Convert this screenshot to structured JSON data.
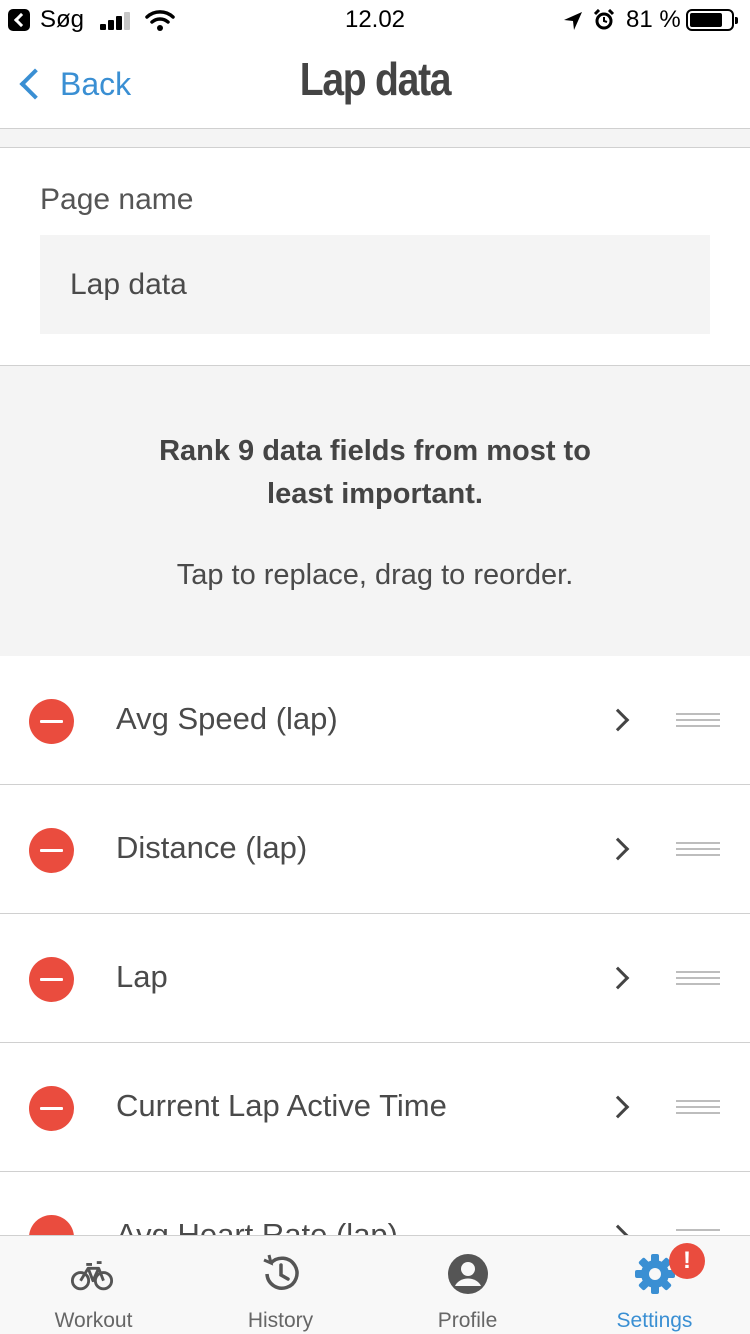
{
  "status_bar": {
    "back_app": "Søg",
    "time": "12.02",
    "battery_percent": "81 %",
    "battery_level": 0.81,
    "icons": [
      "back-to-app-icon",
      "signal-icon",
      "wifi-icon",
      "location-arrow-icon",
      "alarm-icon",
      "battery-icon"
    ]
  },
  "nav": {
    "back_label": "Back",
    "title": "Lap data"
  },
  "page_name": {
    "label": "Page name",
    "value": "Lap data"
  },
  "instructions": {
    "heading": "Rank 9 data fields from most to least important.",
    "subtext": "Tap to replace, drag to reorder."
  },
  "fields": [
    {
      "label": "Avg Speed (lap)"
    },
    {
      "label": "Distance (lap)"
    },
    {
      "label": "Lap"
    },
    {
      "label": "Current Lap Active Time"
    },
    {
      "label": "Avg Heart Rate (lap)"
    }
  ],
  "tabbar": {
    "tabs": [
      {
        "label": "Workout",
        "icon": "bike-icon",
        "active": false
      },
      {
        "label": "History",
        "icon": "history-icon",
        "active": false
      },
      {
        "label": "Profile",
        "icon": "profile-icon",
        "active": false
      },
      {
        "label": "Settings",
        "icon": "gear-icon",
        "active": true
      }
    ],
    "settings_badge": "!"
  },
  "colors": {
    "accent": "#3a8fd3",
    "remove": "#ea4c3e",
    "section_bg": "#f4f4f4"
  }
}
